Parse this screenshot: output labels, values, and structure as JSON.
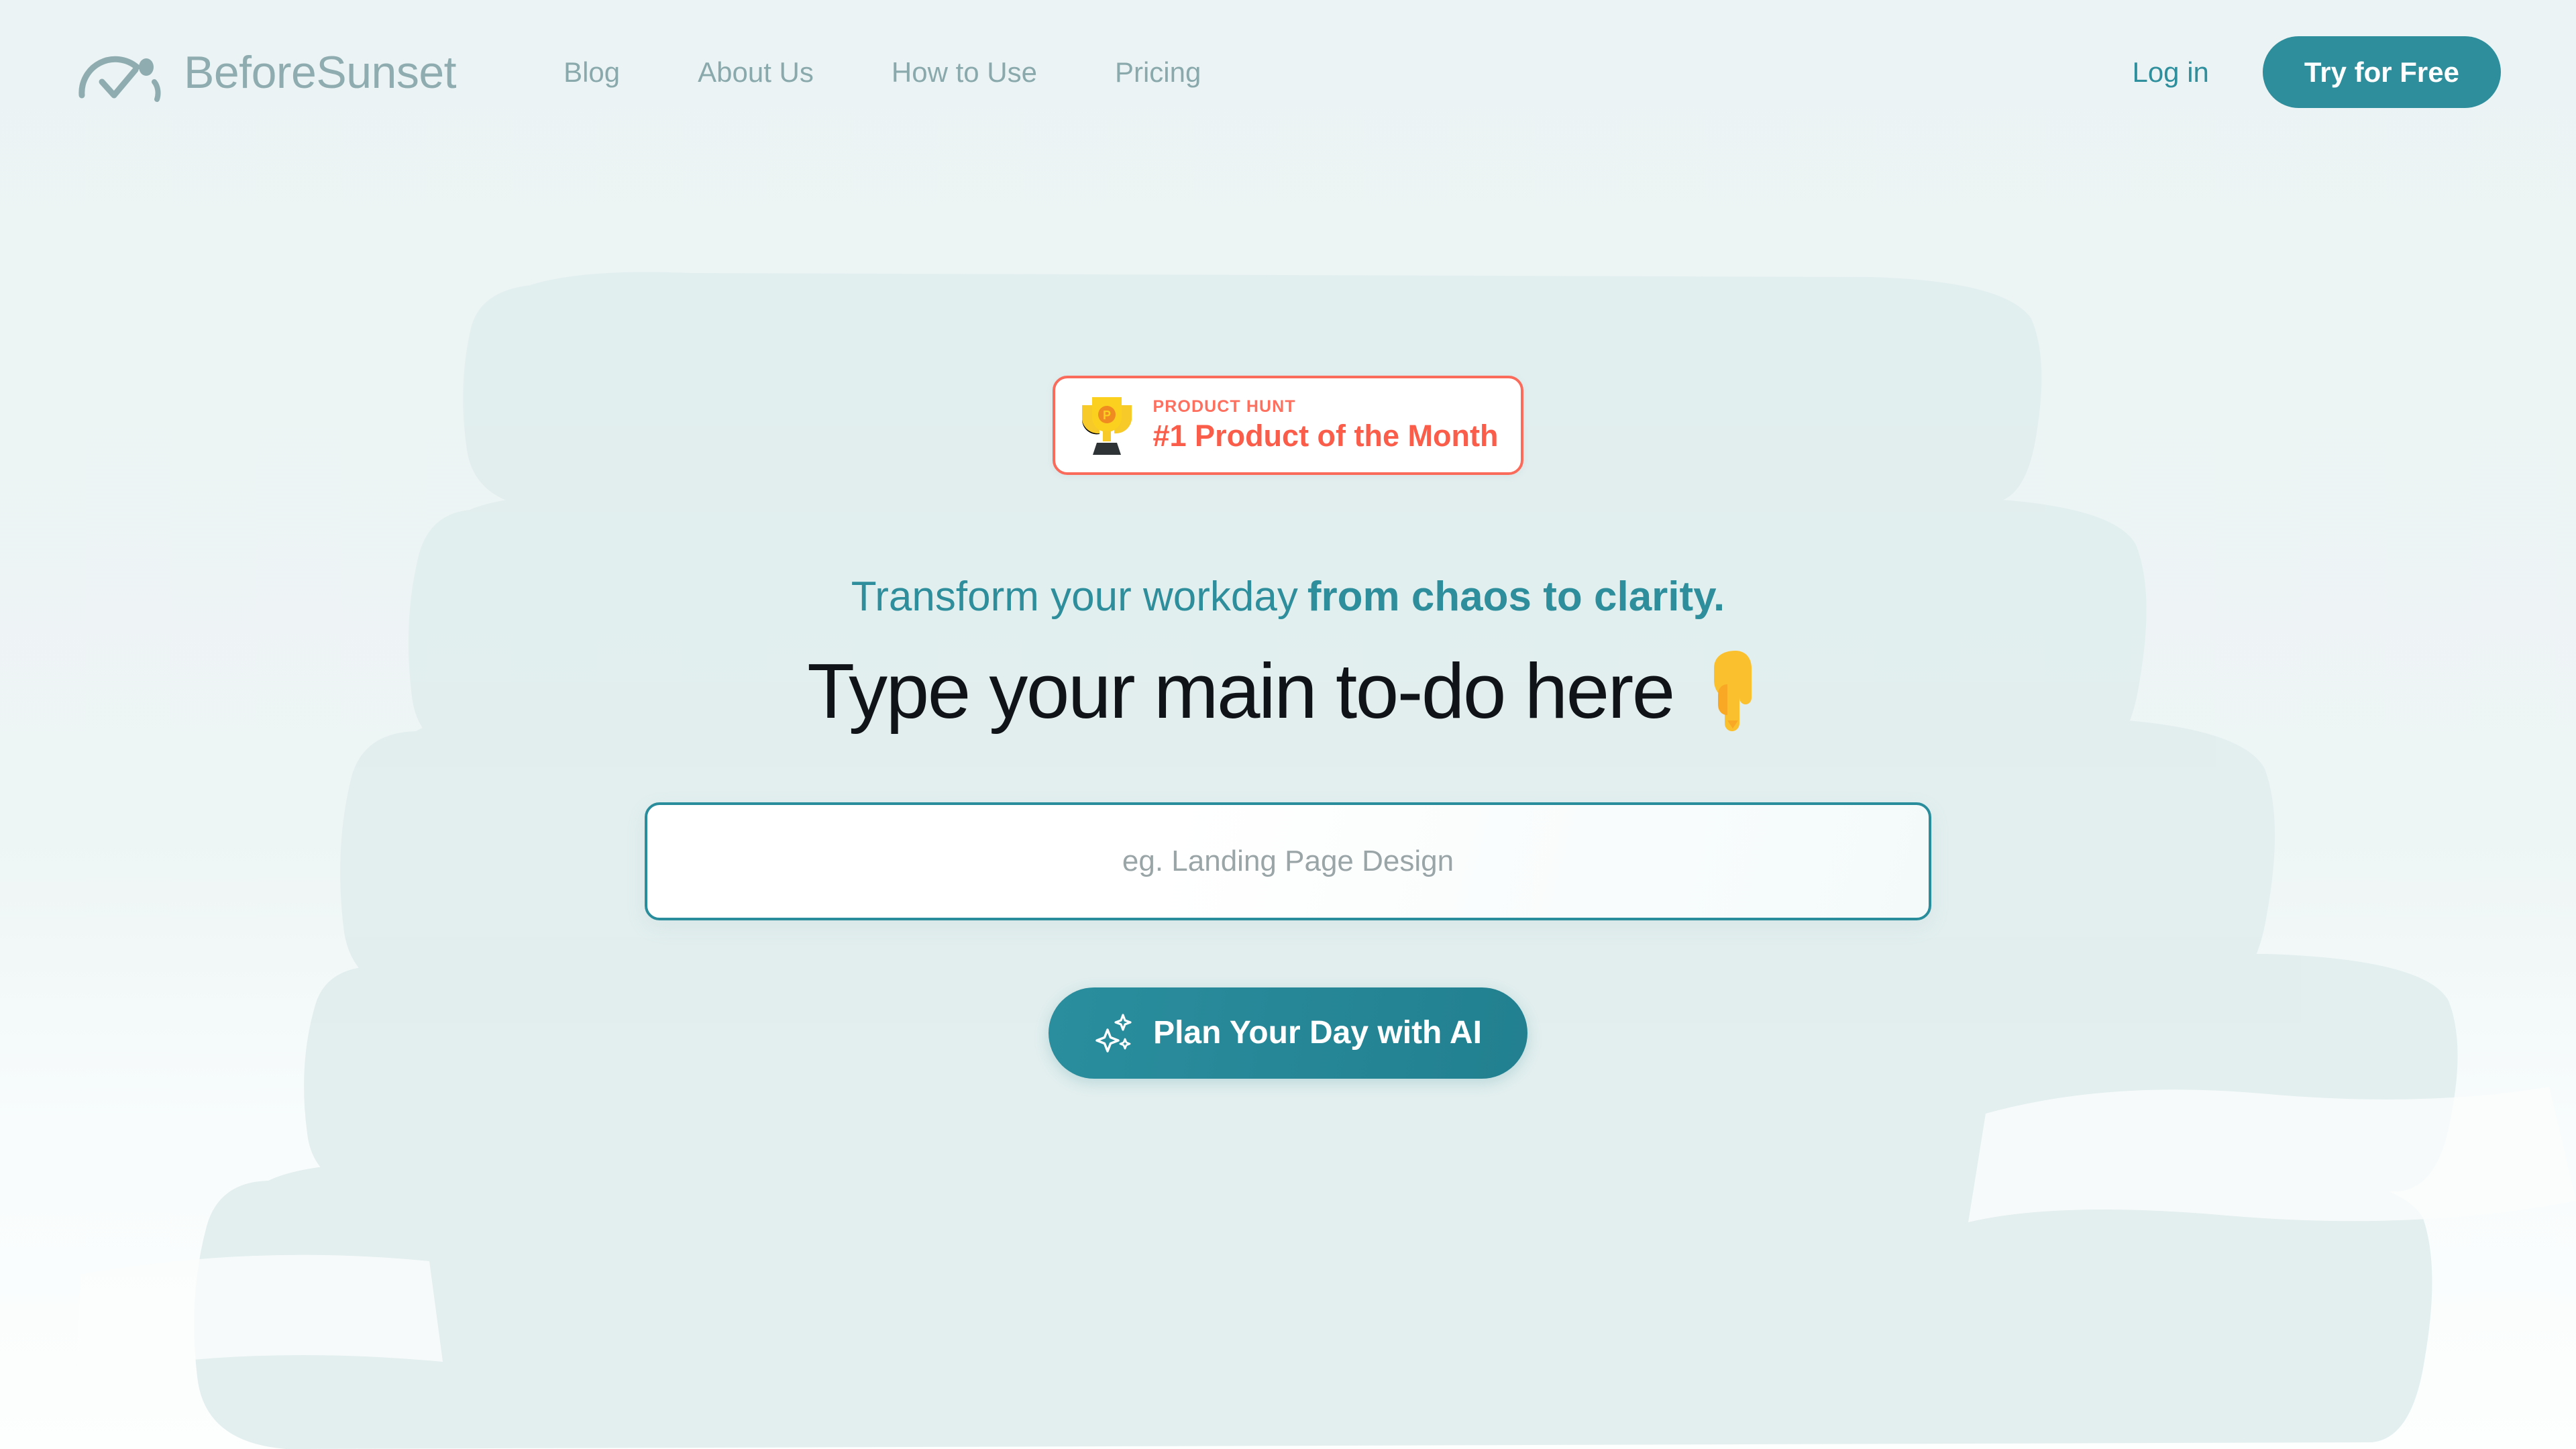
{
  "theme": {
    "page_background": "#edf3f4",
    "brush_stroke": "#dfecec",
    "accent_teal": "#2e8e9c",
    "muted_teal": "#89a9ac",
    "badge_red": "#fb6b5b",
    "heading_dark": "#101418"
  },
  "header": {
    "brand": {
      "name": "BeforeSunset",
      "logo_icon": "sunset-arc-check-icon"
    },
    "nav": [
      {
        "label": "Blog",
        "name": "nav-link-blog"
      },
      {
        "label": "About Us",
        "name": "nav-link-about-us"
      },
      {
        "label": "How to Use",
        "name": "nav-link-how-to-use"
      },
      {
        "label": "Pricing",
        "name": "nav-link-pricing"
      }
    ],
    "login_label": "Log in",
    "cta_label": "Try for Free"
  },
  "hero": {
    "badge": {
      "icon": "trophy-icon",
      "eyebrow": "PRODUCT HUNT",
      "title": "#1 Product of the Month"
    },
    "eyebrow_lead": "Transform your workday",
    "eyebrow_emphasis": "from chaos to clarity.",
    "title": "Type your main to-do here",
    "title_emoji": "point-down-hand-icon",
    "input_placeholder": "eg. Landing Page Design",
    "input_value": "",
    "cta_label": "Plan Your Day with AI",
    "cta_icon": "sparkles-icon"
  }
}
